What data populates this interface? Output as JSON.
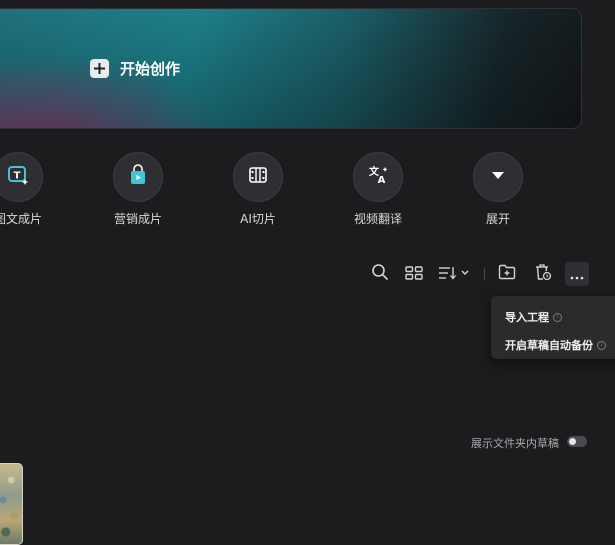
{
  "banner": {
    "create_label": "开始创作"
  },
  "tools": [
    {
      "label": "图文成片",
      "icon": "text-to-video-icon"
    },
    {
      "label": "营销成片",
      "icon": "shopping-bag-icon"
    },
    {
      "label": "AI切片",
      "icon": "film-strip-icon"
    },
    {
      "label": "视频翻译",
      "icon": "translate-icon"
    },
    {
      "label": "展开",
      "icon": "chevron-down-icon"
    }
  ],
  "toolbar": {
    "icons": [
      "search-icon",
      "grid-view-icon",
      "sort-icon",
      "new-folder-icon",
      "trash-icon",
      "more-icon"
    ]
  },
  "menu": {
    "items": [
      {
        "label": "导入工程"
      },
      {
        "label": "开启草稿自动备份"
      }
    ]
  },
  "drafts": {
    "show_folder_drafts_label": "展示文件夹内草稿",
    "show_folder_drafts_on": false
  },
  "colors": {
    "background": "#1c1c1e",
    "accent_teal": "#1d7f8a",
    "accent_magenta": "#963770"
  }
}
